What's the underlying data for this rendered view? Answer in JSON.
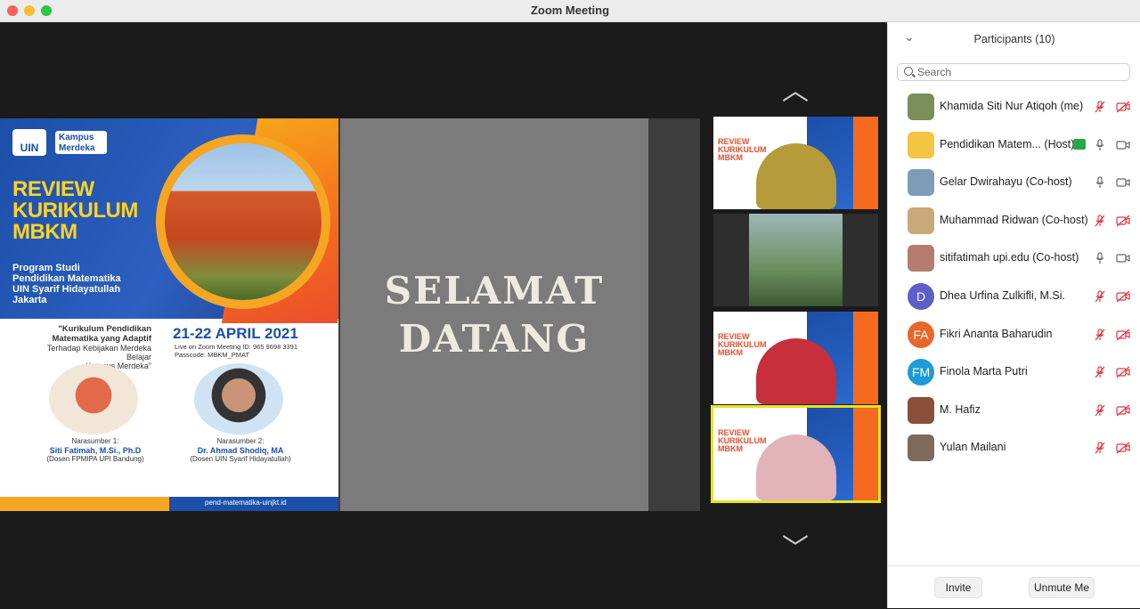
{
  "window": {
    "title": "Zoom Meeting"
  },
  "slide": {
    "logo_uin": "UIN",
    "logo_km": "Kampus Merdeka",
    "heading_lines": [
      "REVIEW",
      "KURIKULUM",
      "MBKM"
    ],
    "program_lines": [
      "Program Studi",
      "Pendidikan Matematika",
      "UIN Syarif Hidayatullah",
      "Jakarta"
    ],
    "quote_lines": [
      "\"Kurikulum Pendidikan",
      "Matematika yang Adaptif",
      "Terhadap Kebijakan Merdeka Belajar",
      "Kampus Merdeka\""
    ],
    "date": "21-22 APRIL 2021",
    "meeting_line": "Live on Zoom Meeting ID: 965 9698 3391",
    "passcode_line": "Passcode: MBKM_PMAT",
    "speaker1": {
      "label": "Narasumber 1:",
      "name": "Siti Fatimah, M.Si., Ph.D",
      "affiliation": "(Dosen FPMIPA UPI Bandung)"
    },
    "speaker2": {
      "label": "Narasumber 2:",
      "name": "Dr. Ahmad Shodiq, MA",
      "affiliation": "(Dosen UIN Syarif Hidayatullah)"
    },
    "website": "pend-matematika-uinjkt.id",
    "welcome_lines": [
      "SELAMAT",
      "DATANG"
    ]
  },
  "thumbnails": {
    "slide_text": "REVIEW KURIKULUM MBKM"
  },
  "participants": {
    "header": "Participants (10)",
    "search_placeholder": "Search",
    "items": [
      {
        "name": "Khamida Siti Nur Atiqoh (me)",
        "initials": "",
        "avatar_color": "#7a8f5a",
        "mic": "muted",
        "cam": "off"
      },
      {
        "name": "Pendidikan Matem... (Host)",
        "initials": "",
        "avatar_color": "#f4c542",
        "mic": "on",
        "cam": "on",
        "sharing": true
      },
      {
        "name": "Gelar Dwirahayu (Co-host)",
        "initials": "",
        "avatar_color": "#7e9cb8",
        "mic": "on",
        "cam": "on"
      },
      {
        "name": "Muhammad Ridwan (Co-host)",
        "initials": "",
        "avatar_color": "#c9a979",
        "mic": "muted",
        "cam": "off"
      },
      {
        "name": "sitifatimah upi.edu (Co-host)",
        "initials": "",
        "avatar_color": "#b67c6f",
        "mic": "on",
        "cam": "on"
      },
      {
        "name": "Dhea Urfina Zulkifli, M.Si.",
        "initials": "D",
        "avatar_color": "#5b5fc7",
        "mic": "muted",
        "cam": "off"
      },
      {
        "name": "Fikri Ananta Baharudin",
        "initials": "FA",
        "avatar_color": "#e8672b",
        "mic": "muted",
        "cam": "off"
      },
      {
        "name": "Finola Marta Putri",
        "initials": "FM",
        "avatar_color": "#1f9ad6",
        "mic": "muted",
        "cam": "off"
      },
      {
        "name": "M. Hafiz",
        "initials": "",
        "avatar_color": "#8a4f3a",
        "mic": "muted",
        "cam": "off"
      },
      {
        "name": "Yulan Mailani",
        "initials": "",
        "avatar_color": "#7d6a5c",
        "mic": "muted",
        "cam": "off"
      }
    ],
    "invite_label": "Invite",
    "unmute_label": "Unmute Me"
  },
  "colors": {
    "muted_red": "#e0383e",
    "icon_gray": "#666666",
    "active_border": "#e6e21f",
    "share_green": "#27a845"
  }
}
